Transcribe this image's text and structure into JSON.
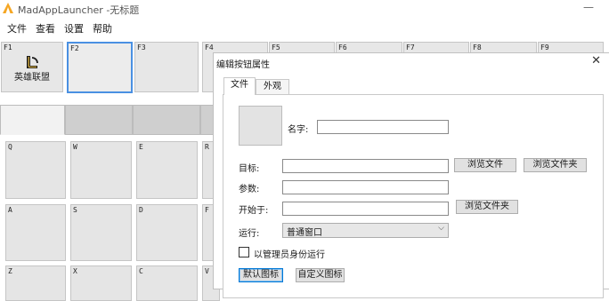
{
  "window": {
    "title": "MadAppLauncher -无标题",
    "minimize_glyph": "—"
  },
  "menu": [
    "文件",
    "查看",
    "设置",
    "帮助"
  ],
  "fkeys": [
    {
      "label": "F1",
      "app": "英雄联盟"
    },
    {
      "label": "F2",
      "app": ""
    },
    {
      "label": "F3",
      "app": ""
    },
    {
      "label": "F4",
      "app": ""
    },
    {
      "label": "F5",
      "app": ""
    },
    {
      "label": "F6",
      "app": ""
    },
    {
      "label": "F7",
      "app": ""
    },
    {
      "label": "F8",
      "app": ""
    },
    {
      "label": "F9",
      "app": ""
    }
  ],
  "keys": {
    "row1": [
      "Q",
      "W",
      "E",
      "R"
    ],
    "row2": [
      "A",
      "S",
      "D",
      "F"
    ],
    "row3": [
      "Z",
      "X",
      "C",
      "V"
    ]
  },
  "dialog": {
    "title": "编辑按钮属性",
    "close_glyph": "✕",
    "tabs": [
      "文件",
      "外观"
    ],
    "name_label": "名字:",
    "name_value": "",
    "target_label": "目标:",
    "target_value": "",
    "browse_file": "浏览文件",
    "browse_folder": "浏览文件夹",
    "params_label": "参数:",
    "params_value": "",
    "start_in_label": "开始于:",
    "start_in_value": "",
    "start_in_browse": "浏览文件夹",
    "run_label": "运行:",
    "run_value": "普通窗口",
    "run_arrow": "⌵",
    "admin_label": "以管理员身份运行",
    "admin_checked": false,
    "default_icon": "默认图标",
    "custom_icon": "自定义图标"
  },
  "colors": {
    "accent": "#4a90e2",
    "app_icon": "#f5a623"
  }
}
